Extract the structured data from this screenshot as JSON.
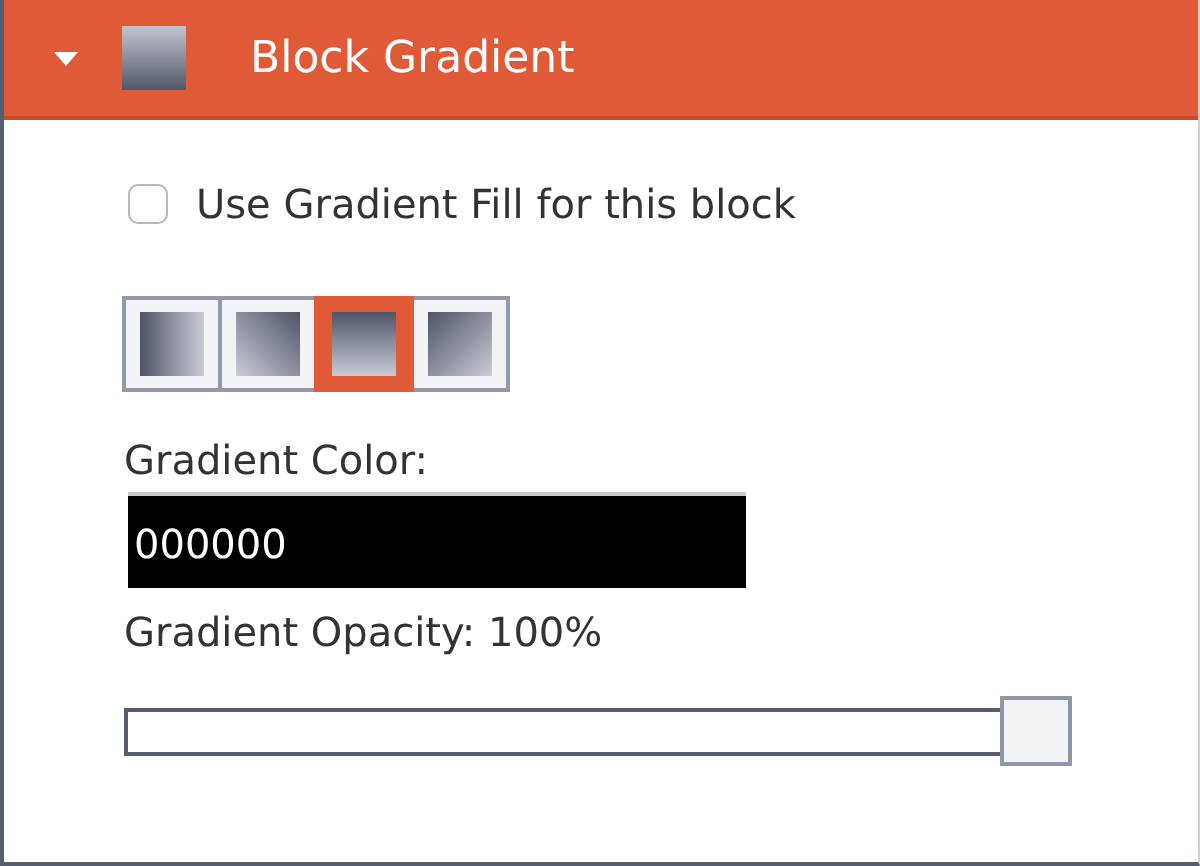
{
  "header": {
    "title": "Block Gradient",
    "expanded": true
  },
  "use_gradient": {
    "label": "Use Gradient Fill for this block",
    "checked": false
  },
  "gradient_directions": [
    {
      "kind": "horizontal",
      "selected": false
    },
    {
      "kind": "diagonal-up",
      "selected": false
    },
    {
      "kind": "vertical",
      "selected": true
    },
    {
      "kind": "diagonal-down",
      "selected": false
    }
  ],
  "gradient_color": {
    "label": "Gradient Color:",
    "value": "000000"
  },
  "gradient_opacity": {
    "label": "Gradient Opacity: 100%",
    "level": 1
  }
}
